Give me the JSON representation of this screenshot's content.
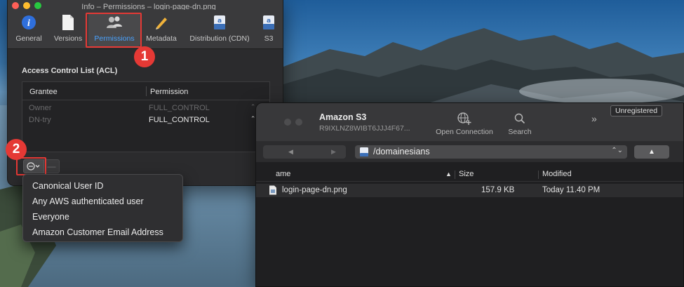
{
  "info_window": {
    "title": "Info – Permissions – login-page-dn.png",
    "tabs": [
      {
        "label": "General",
        "icon": "info-icon"
      },
      {
        "label": "Versions",
        "icon": "document-icon"
      },
      {
        "label": "Permissions",
        "icon": "users-icon",
        "active": true
      },
      {
        "label": "Metadata",
        "icon": "pencil-icon"
      },
      {
        "label": "Distribution (CDN)",
        "icon": "drive-icon"
      },
      {
        "label": "S3",
        "icon": "drive-icon"
      }
    ],
    "acl": {
      "section_title": "Access Control List (ACL)",
      "columns": [
        "Grantee",
        "Permission"
      ],
      "rows": [
        {
          "grantee": "Owner",
          "permission": "FULL_CONTROL",
          "enabled": false
        },
        {
          "grantee": "DN-try",
          "permission": "FULL_CONTROL",
          "enabled": true
        }
      ]
    },
    "add_button_icon": "ellipsis-circle-icon",
    "remove_label": "—",
    "help_label": "?"
  },
  "dropdown": {
    "items": [
      "Canonical User ID",
      "Any AWS authenticated user",
      "Everyone",
      "Amazon Customer Email Address"
    ]
  },
  "annotations": {
    "badge_1": "1",
    "badge_2": "2",
    "color": "#e53935"
  },
  "browser": {
    "title": "Amazon S3",
    "subtitle": "R9IXLNZ8WIBT6JJJ4F67...",
    "open_connection": "Open Connection",
    "search": "Search",
    "unregistered": "Unregistered",
    "path": "/domainesians",
    "columns": {
      "name": "ame",
      "size": "Size",
      "modified": "Modified"
    },
    "files": [
      {
        "name": "login-page-dn.png",
        "size": "157.9 KB",
        "modified": "Today 11.40 PM"
      }
    ]
  },
  "colors": {
    "accent": "#4aa3ff",
    "annotation_red": "#e53935",
    "window_bg": "#2b2b2d"
  }
}
